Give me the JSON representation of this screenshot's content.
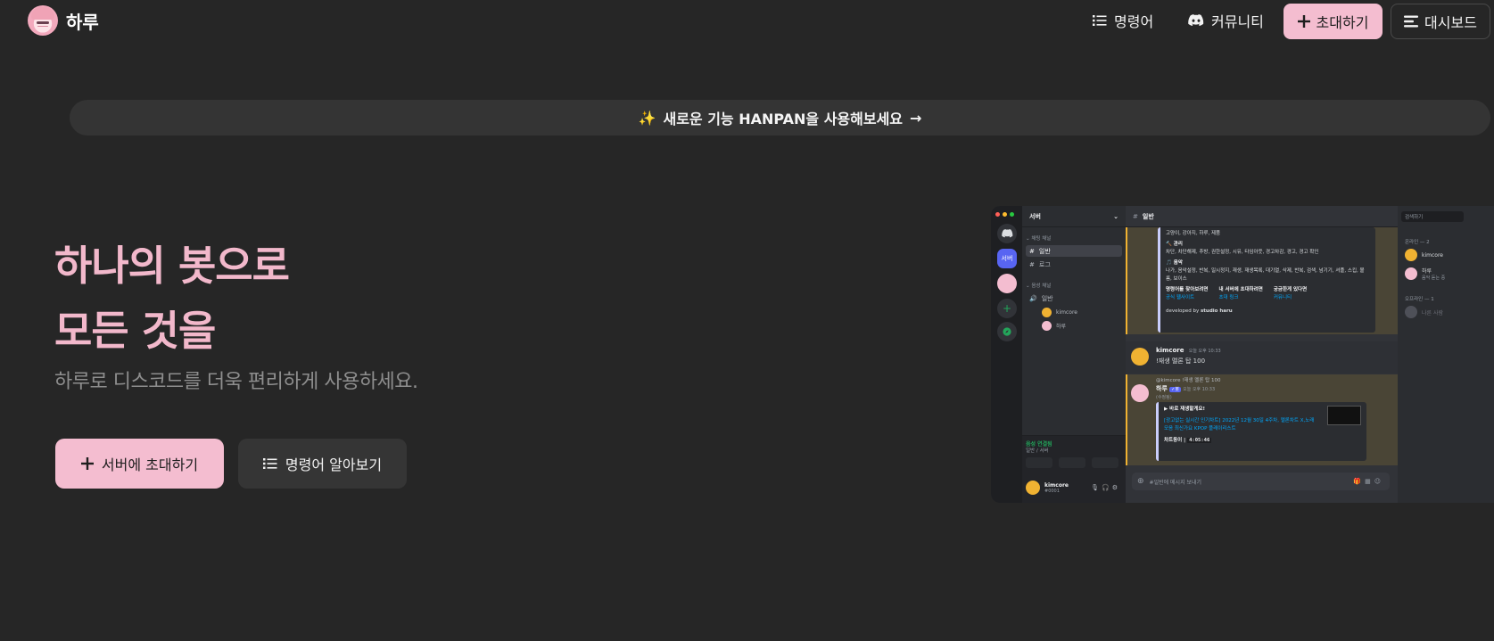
{
  "nav": {
    "brand": "하루",
    "commands": "명령어",
    "community": "커뮤니티",
    "invite": "초대하기",
    "dashboard": "대시보드"
  },
  "banner": {
    "emoji": "✨",
    "text": "새로운 기능 HANPAN을 사용해보세요",
    "arrow": "→"
  },
  "hero": {
    "line1": "하나의 봇으로",
    "line2": "모든 것을",
    "subtitle": "하루로 디스코드를 더욱 편리하게 사용하세요.",
    "invite_button": "서버에 초대하기",
    "commands_button": "명령어 알아보기"
  },
  "preview": {
    "server_name": "서버",
    "rail_server_label": "서버",
    "text_category": "채팅 채널",
    "voice_category": "음성 채널",
    "channels": [
      "일반",
      "로그"
    ],
    "voice_channel": "일반",
    "voice_users": [
      "kimcore",
      "하루"
    ],
    "voice_status": "음성 연결됨",
    "voice_location": "일반 / 서버",
    "user_name": "kimcore",
    "user_tag": "#0001",
    "channel_title": "일반",
    "embed_top_text": "고양이, 강아지, 하루, 제품",
    "embed_mgmt_title": "🔨 관리",
    "embed_mgmt_text": "차단, 차단해제, 추방, 권한설정, 시유, 타임아웃, 경고차감, 경고, 경고 확인",
    "embed_music_title": "🎵 음악",
    "embed_music_text": "나가, 음악설정, 반복, 일시정지, 재생, 재생목록, 대기열, 삭제, 반복, 검색, 넘기기, 셔플, 스킵, 볼륨, 보이스",
    "embed_links": [
      {
        "head": "명령어를 찾아보려면",
        "link": "공식 웹사이트"
      },
      {
        "head": "내 서버에 초대하려면",
        "link": "초대 링크"
      },
      {
        "head": "궁금한게 있다면",
        "link": "커뮤니티"
      }
    ],
    "developed_by": "developed by",
    "studio": "studio haru",
    "msg1_author": "kimcore",
    "msg1_time": "오늘 오후 10:33",
    "msg1_text": "!재생 멜론 탑 100",
    "msg2_reply": "@kimcore !재생 멜론 탑 100",
    "msg2_author": "하루",
    "msg2_badge": "✓봇",
    "msg2_time": "오늘 오후 10:33",
    "msg2_edited": "(수정됨)",
    "now_playing": "▶ 바로 재생할게요!",
    "track_title": "[광고없는 실시간 인기차트] 2022년 12월 30일 4주차, 멜론차트 X,노래모음 최신가요 KPOP 플레이리스트",
    "duration_label": "차트동이 |",
    "duration": "4:05:46",
    "input_placeholder": "#일반에 메시지 보내기",
    "search_placeholder": "검색하기",
    "online_label": "온라인 — 2",
    "offline_label": "오프라인 — 1",
    "members_online": [
      {
        "name": "kimcore",
        "sub": ""
      },
      {
        "name": "하루",
        "sub": "음악 듣는 중"
      }
    ],
    "members_offline": [
      {
        "name": "나른 사람"
      }
    ],
    "colors": {
      "accent": "#f4bdd0",
      "blurple": "#5865f2",
      "link": "#00a8fc",
      "online": "#23a55a"
    }
  }
}
